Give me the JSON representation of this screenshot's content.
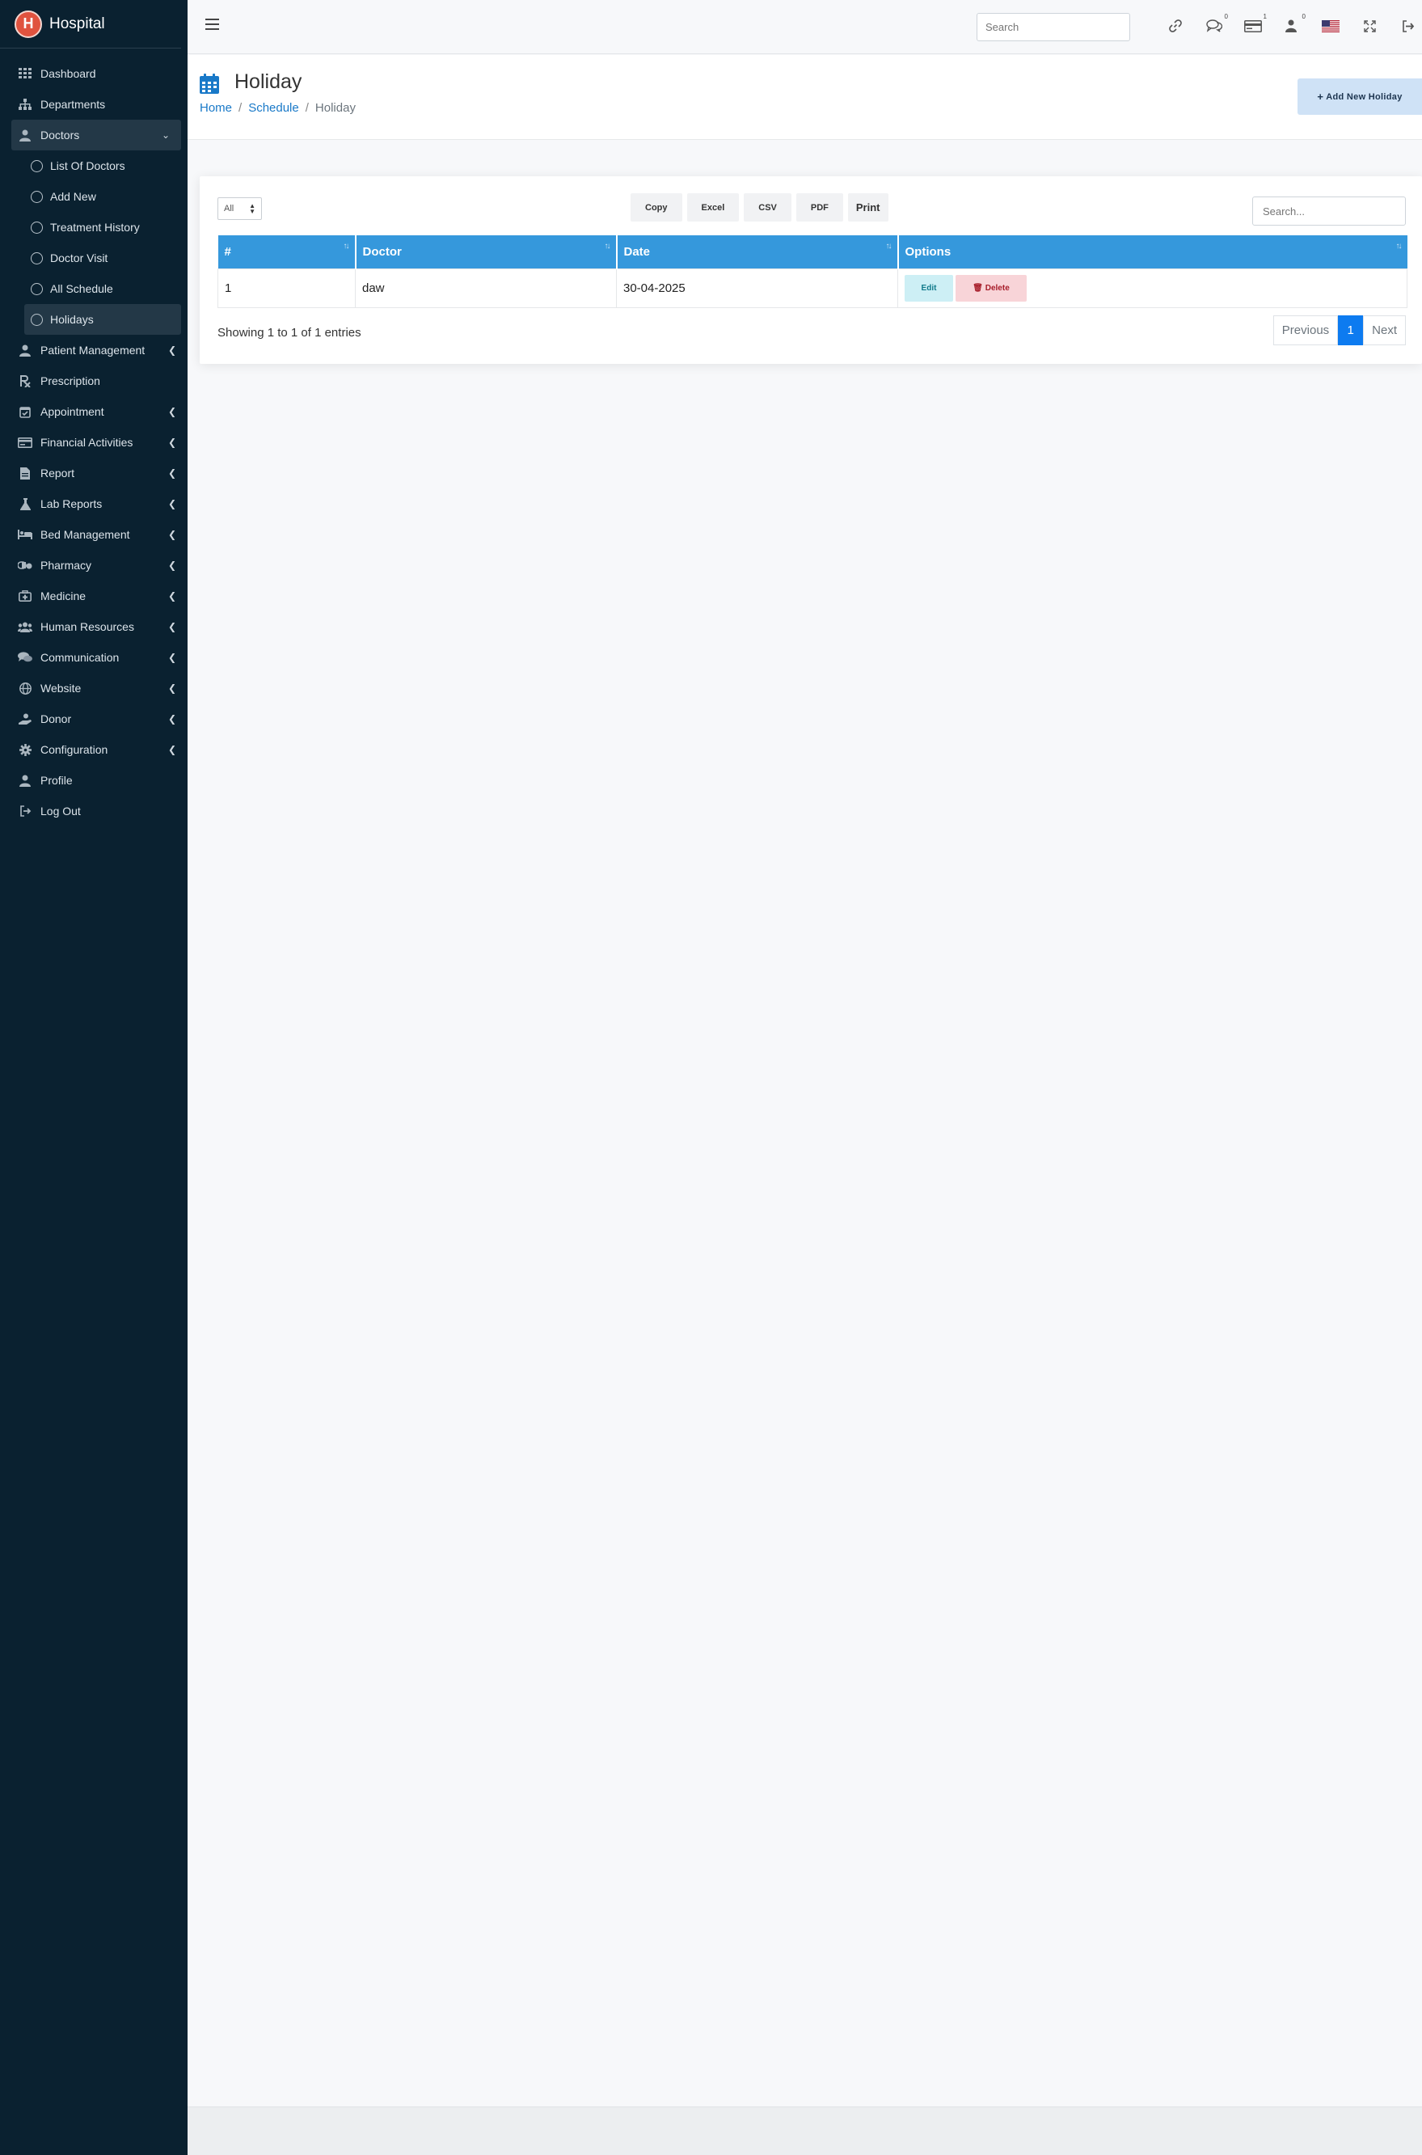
{
  "brand": {
    "name": "Hospital"
  },
  "sidebar": {
    "items": [
      {
        "label": "Dashboard",
        "icon": "dashboard-grid-icon",
        "has_children": false
      },
      {
        "label": "Departments",
        "icon": "sitemap-icon",
        "has_children": false
      },
      {
        "label": "Doctors",
        "icon": "doctor-icon",
        "has_children": true,
        "open": true
      },
      {
        "label": "Patient Management",
        "icon": "user-icon",
        "has_children": true
      },
      {
        "label": "Prescription",
        "icon": "prescription-icon",
        "has_children": false
      },
      {
        "label": "Appointment",
        "icon": "calendar-check-icon",
        "has_children": true
      },
      {
        "label": "Financial Activities",
        "icon": "money-icon",
        "has_children": true
      },
      {
        "label": "Report",
        "icon": "report-icon",
        "has_children": true
      },
      {
        "label": "Lab Reports",
        "icon": "flask-icon",
        "has_children": true
      },
      {
        "label": "Bed Management",
        "icon": "bed-icon",
        "has_children": true
      },
      {
        "label": "Pharmacy",
        "icon": "pills-icon",
        "has_children": true
      },
      {
        "label": "Medicine",
        "icon": "medkit-icon",
        "has_children": true
      },
      {
        "label": "Human Resources",
        "icon": "users-icon",
        "has_children": true
      },
      {
        "label": "Communication",
        "icon": "comments-icon",
        "has_children": true
      },
      {
        "label": "Website",
        "icon": "globe-icon",
        "has_children": true
      },
      {
        "label": "Donor",
        "icon": "donor-hand-icon",
        "has_children": true
      },
      {
        "label": "Configuration",
        "icon": "gear-icon",
        "has_children": true
      },
      {
        "label": "Profile",
        "icon": "user-icon",
        "has_children": false
      },
      {
        "label": "Log Out",
        "icon": "logout-icon",
        "has_children": false
      }
    ],
    "doctors_sub": [
      {
        "label": "List Of Doctors"
      },
      {
        "label": "Add New"
      },
      {
        "label": "Treatment History"
      },
      {
        "label": "Doctor Visit"
      },
      {
        "label": "All Schedule"
      },
      {
        "label": "Holidays",
        "active": true
      }
    ]
  },
  "topbar": {
    "search_placeholder": "Search",
    "badges": {
      "messages": "0",
      "billing": "1",
      "users": "0"
    }
  },
  "header": {
    "title": "Holiday",
    "breadcrumb": [
      "Home",
      "Schedule",
      "Holiday"
    ],
    "add_button": "Add New Holiday"
  },
  "table_tools": {
    "length_value": "All",
    "exports": [
      "Copy",
      "Excel",
      "CSV",
      "PDF",
      "Print"
    ],
    "search_placeholder": "Search..."
  },
  "table": {
    "columns": [
      "#",
      "Doctor",
      "Date",
      "Options"
    ],
    "rows": [
      {
        "num": "1",
        "doctor": "daw",
        "date": "30-04-2025",
        "edit": "Edit",
        "delete": "Delete"
      }
    ]
  },
  "footer_info": "Showing 1 to 1 of 1 entries",
  "pagination": {
    "previous": "Previous",
    "page": "1",
    "next": "Next"
  },
  "colors": {
    "sidebar_bg": "#0a2130",
    "header_blue": "#3598dc",
    "active_page": "#0d7bf0"
  }
}
